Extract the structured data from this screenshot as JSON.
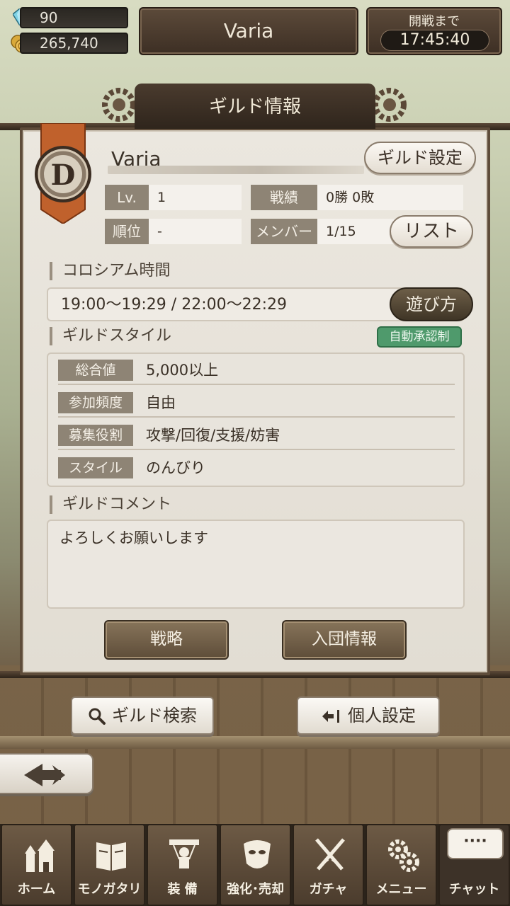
{
  "resources": {
    "gems": "90",
    "coins": "265,740"
  },
  "header": {
    "title": "Varia",
    "battle_label": "開戦まで",
    "battle_timer": "17:45:40"
  },
  "panel": {
    "title": "ギルド情報",
    "emblem_letter": "D",
    "guild_name": "Varia",
    "settings_button": "ギルド設定",
    "stats": {
      "lv_label": "Lv.",
      "lv_value": "1",
      "rank_label": "順位",
      "rank_value": "-",
      "record_label": "戦績",
      "record_value": "0勝 0敗",
      "member_label": "メンバー",
      "member_value": "1/15"
    },
    "list_button": "リスト",
    "coliseum": {
      "title": "コロシアム時間",
      "times": "19:00～19:29 / 22:00～22:29",
      "howto_button": "遊び方"
    },
    "style": {
      "title": "ギルドスタイル",
      "badge": "自動承認制",
      "rows": [
        {
          "label": "総合値",
          "value": "5,000以上"
        },
        {
          "label": "参加頻度",
          "value": "自由"
        },
        {
          "label": "募集役割",
          "value": "攻撃/回復/支援/妨害"
        },
        {
          "label": "スタイル",
          "value": "のんびり"
        }
      ]
    },
    "comment": {
      "title": "ギルドコメント",
      "text": "よろしくお願いします"
    },
    "strategy_button": "戦略",
    "join_info_button": "入団情報"
  },
  "actions": {
    "guild_search": "ギルド検索",
    "personal_settings": "個人設定"
  },
  "nav": {
    "items": [
      {
        "label": "ホーム",
        "icon": "home-icon"
      },
      {
        "label": "モノガタリ",
        "icon": "book-icon"
      },
      {
        "label": "装 備",
        "icon": "equipment-icon"
      },
      {
        "label": "強化･売却",
        "icon": "mask-icon"
      },
      {
        "label": "ガチャ",
        "icon": "swords-icon"
      },
      {
        "label": "メニュー",
        "icon": "gears-icon"
      },
      {
        "label": "チャット",
        "icon": "chat-icon"
      }
    ],
    "chat_bubble": "····"
  }
}
